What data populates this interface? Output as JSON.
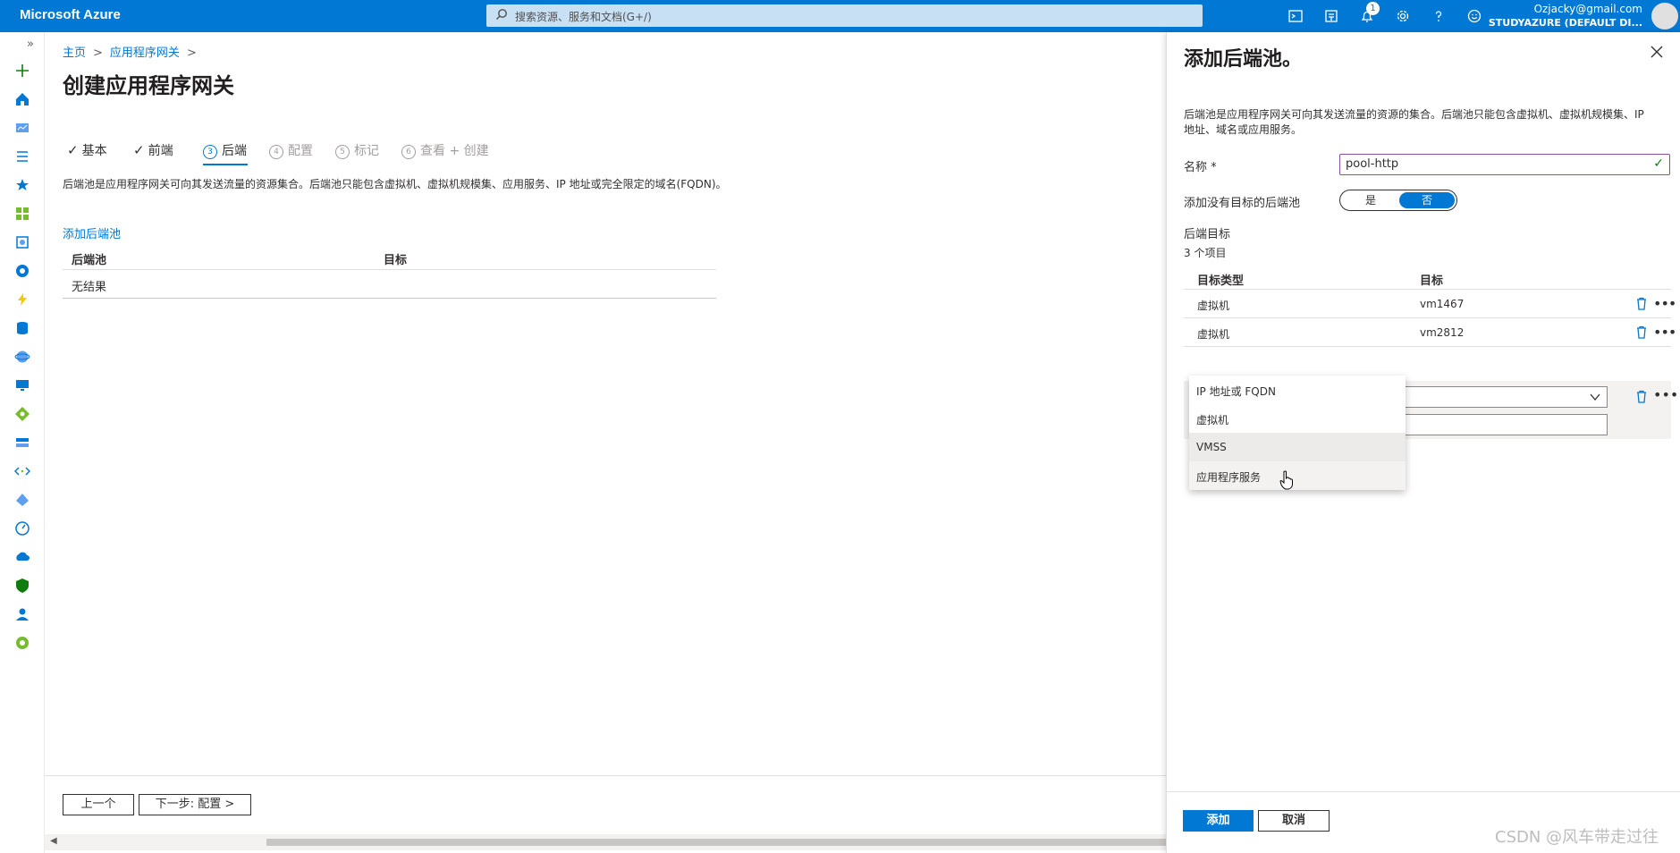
{
  "app": {
    "title": "Microsoft Azure"
  },
  "search": {
    "placeholder": "搜索资源、服务和文档(G+/)"
  },
  "topbar": {
    "icons": [
      "cloud-shell-icon",
      "directory-filter-icon",
      "bell-icon",
      "gear-icon",
      "help-icon",
      "feedback-icon"
    ],
    "notification_count": "1",
    "account_email": "Ozjacky@gmail.com",
    "account_tenant": "STUDYAZURE (DEFAULT DI..."
  },
  "leftnav": {
    "expand": "»",
    "icons": [
      "plus-icon",
      "home-icon",
      "dashboard-icon",
      "all-services-icon",
      "favorites-star-icon",
      "all-resources-icon",
      "resource-groups-icon",
      "app-services-icon",
      "function-app-icon",
      "sql-database-icon",
      "azure-cosmos-icon",
      "virtual-machines-icon",
      "load-balancer-icon",
      "storage-accounts-icon",
      "virtual-networks-icon",
      "azure-ad-icon",
      "monitor-icon",
      "advisor-icon",
      "security-center-icon",
      "cost-management-icon",
      "help-support-icon"
    ]
  },
  "breadcrumb": {
    "home": "主页",
    "sep": ">",
    "item": "应用程序网关"
  },
  "page": {
    "title": "创建应用程序网关"
  },
  "steps": [
    {
      "label": "基本",
      "state": "done"
    },
    {
      "label": "前端",
      "state": "done"
    },
    {
      "num": "3",
      "label": "后端",
      "state": "active"
    },
    {
      "num": "4",
      "label": "配置",
      "state": "pending"
    },
    {
      "num": "5",
      "label": "标记",
      "state": "pending"
    },
    {
      "num": "6",
      "label": "查看 + 创建",
      "state": "pending"
    }
  ],
  "main": {
    "description": "后端池是应用程序网关可向其发送流量的资源集合。后端池只能包含虚拟机、虚拟机规模集、应用服务、IP 地址或完全限定的域名(FQDN)。",
    "add_pool_link": "添加后端池",
    "grid": {
      "headers": [
        "后端池",
        "目标"
      ],
      "empty": "无结果"
    }
  },
  "footer": {
    "prev": "上一个",
    "next": "下一步: 配置 >"
  },
  "panel": {
    "title": "添加后端池。",
    "description": "后端池是应用程序网关可向其发送流量的资源的集合。后端池只能包含虚拟机、虚拟机规模集、IP 地址、域名或应用服务。",
    "name_label": "名称 *",
    "name_value": "pool-http",
    "no_target_label": "添加没有目标的后端池",
    "toggle_yes": "是",
    "toggle_no": "否",
    "targets_title": "后端目标",
    "targets_count": "3 个项目",
    "target_headers": [
      "目标类型",
      "目标"
    ],
    "targets": [
      {
        "type": "虚拟机",
        "target": "vm1467"
      },
      {
        "type": "虚拟机",
        "target": "vm2812"
      }
    ],
    "editing_type": "VMSS",
    "more": "•••",
    "dropdown_options": [
      "IP 地址或 FQDN",
      "虚拟机",
      "VMSS",
      "应用程序服务"
    ],
    "dropdown_selected": "VMSS",
    "add_button": "添加",
    "cancel_button": "取消"
  },
  "watermark": "CSDN @风车带走过往",
  "colors": {
    "topbar": "#0078d4",
    "accent": "#0078d4",
    "valid": "#107c10",
    "name_border": "#8a4f9e"
  }
}
